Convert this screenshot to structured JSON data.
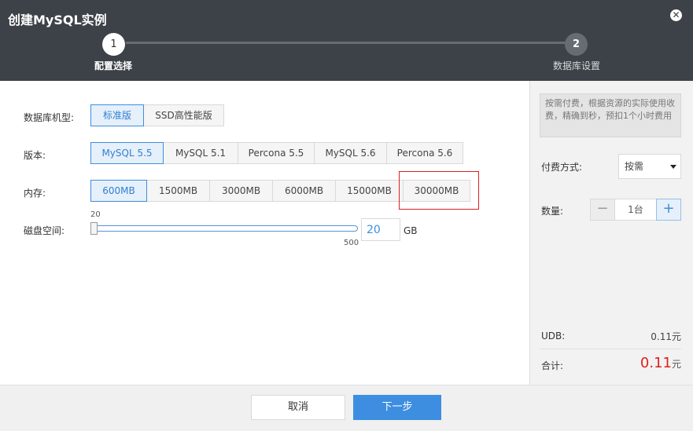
{
  "dialog": {
    "title": "创建MySQL实例"
  },
  "steps": [
    {
      "number": "1",
      "label": "配置选择"
    },
    {
      "number": "2",
      "label": "数据库设置"
    }
  ],
  "form": {
    "db_type": {
      "label": "数据库机型:",
      "options": [
        "标准版",
        "SSD高性能版"
      ],
      "selected": "标准版"
    },
    "version": {
      "label": "版本:",
      "options": [
        "MySQL 5.5",
        "MySQL 5.1",
        "Percona 5.5",
        "MySQL 5.6",
        "Percona 5.6"
      ],
      "selected": "MySQL 5.5"
    },
    "memory": {
      "label": "内存:",
      "options": [
        "600MB",
        "1500MB",
        "3000MB",
        "6000MB",
        "15000MB",
        "30000MB"
      ],
      "selected": "600MB"
    },
    "disk": {
      "label": "磁盘空间:",
      "min": "20",
      "max": "500",
      "value": "20",
      "unit": "GB"
    }
  },
  "side": {
    "note": "按需付费，根据资源的实际使用收费，精确到秒，预扣1个小时费用",
    "payment": {
      "label": "付费方式:",
      "value": "按需"
    },
    "quantity": {
      "label": "数量:",
      "minus": "−",
      "value": "1台",
      "plus": "+"
    },
    "udb": {
      "label": "UDB:",
      "value": "0.11元"
    },
    "total": {
      "label": "合计:",
      "value": "0.11",
      "unit": "元"
    }
  },
  "footer": {
    "cancel": "取消",
    "next": "下一步"
  },
  "colors": {
    "header_bg": "#3c4248",
    "accent": "#3d8ee0",
    "price": "#e02020",
    "highlight_box": "#e02020"
  }
}
